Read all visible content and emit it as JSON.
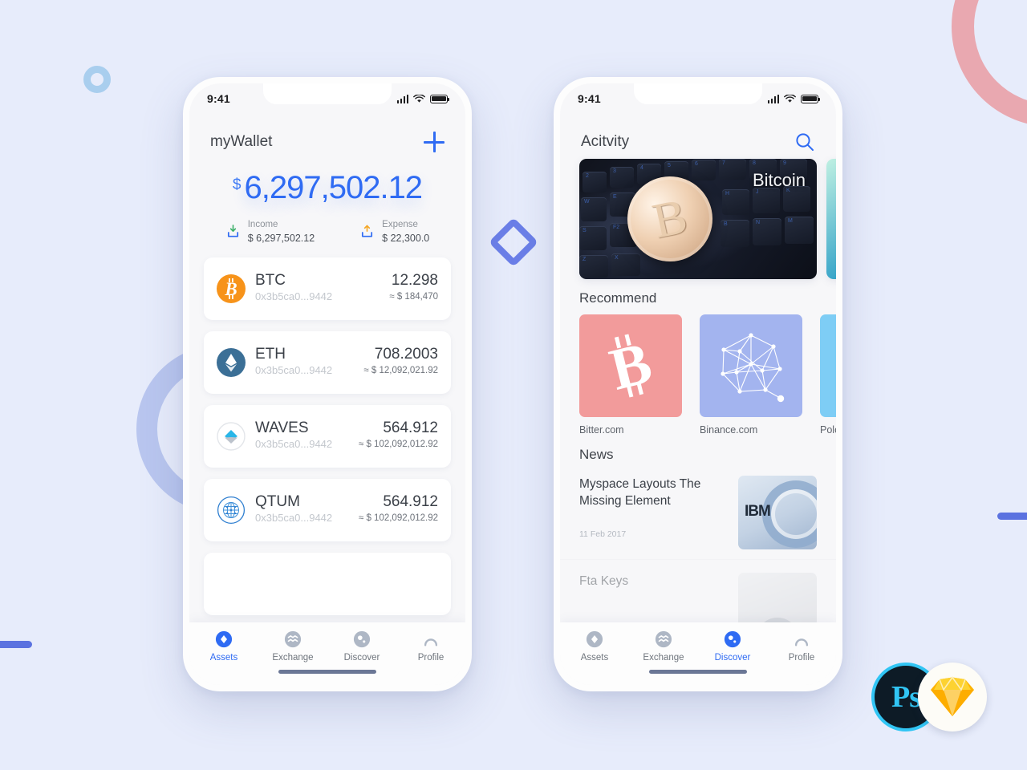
{
  "theme": {
    "background": "#e7ecfb",
    "accent": "#2f6bf3",
    "pink_ring": "#e9a8b0",
    "periwinkle_ring": "#b9c6ef",
    "small_ring": "#a9ceee",
    "diamond": "#6b7fe8",
    "bar": "#5b72e0"
  },
  "decor": {
    "pink_ring_name": "pink-ring",
    "periwinkle_ring_name": "periwinkle-ring",
    "small_ring_name": "small-blue-ring",
    "diamond_name": "diamond-outline",
    "bar_left_name": "blue-bar-left",
    "bar_right_name": "blue-bar-right"
  },
  "badges": {
    "photoshop_label": "Ps",
    "sketch_label": "Sketch"
  },
  "statusbar": {
    "time": "9:41",
    "signal_icon": "cellular-signal-icon",
    "wifi_icon": "wifi-icon",
    "battery_icon": "battery-icon"
  },
  "wallet": {
    "title": "myWallet",
    "add_icon": "plus-icon",
    "balance_currency": "$",
    "balance": "6,297,502.12",
    "income": {
      "label": "Income",
      "value": "$ 6,297,502.12",
      "icon": "income-arrow-icon"
    },
    "expense": {
      "label": "Expense",
      "value": "$ 22,300.0",
      "icon": "expense-arrow-icon"
    },
    "assets": [
      {
        "symbol": "BTC",
        "address": "0x3b5ca0...9442",
        "amount": "12.298",
        "usd": "≈ $ 184,470",
        "icon": "bitcoin-icon"
      },
      {
        "symbol": "ETH",
        "address": "0x3b5ca0...9442",
        "amount": "708.2003",
        "usd": "≈ $ 12,092,021.92",
        "icon": "ethereum-icon"
      },
      {
        "symbol": "WAVES",
        "address": "0x3b5ca0...9442",
        "amount": "564.912",
        "usd": "≈ $ 102,092,012.92",
        "icon": "waves-icon"
      },
      {
        "symbol": "QTUM",
        "address": "0x3b5ca0...9442",
        "amount": "564.912",
        "usd": "≈ $ 102,092,012.92",
        "icon": "qtum-icon"
      }
    ]
  },
  "discover": {
    "title": "Acitvity",
    "search_icon": "search-icon",
    "banners": [
      {
        "label": "Bitcoin",
        "image": "bitcoin-coin-on-keyboard"
      },
      {
        "label": "",
        "image": "teal-abstract"
      }
    ],
    "recommend_title": "Recommend",
    "recommend": [
      {
        "name": "Bitter.com",
        "color": "#f29b9b",
        "icon": "bitcoin-glyph-icon"
      },
      {
        "name": "Binance.com",
        "color": "#a3b4ef",
        "icon": "network-mesh-icon"
      },
      {
        "name": "Polone",
        "color": "#7ecdf5",
        "icon": "sparkle-icon"
      }
    ],
    "news_title": "News",
    "news": [
      {
        "title": "Myspace Layouts The Missing Element",
        "date": "11 Feb 2017",
        "thumb": "ibm-server-photo"
      },
      {
        "title": "Fta Keys",
        "date": "",
        "thumb": "portrait-photo"
      }
    ]
  },
  "tabbar": {
    "tabs": [
      {
        "label": "Assets",
        "icon": "assets-diamond-icon"
      },
      {
        "label": "Exchange",
        "icon": "exchange-waves-icon"
      },
      {
        "label": "Discover",
        "icon": "discover-compass-icon"
      },
      {
        "label": "Profile",
        "icon": "profile-person-icon"
      }
    ],
    "active_wallet": "Assets",
    "active_discover": "Discover"
  }
}
